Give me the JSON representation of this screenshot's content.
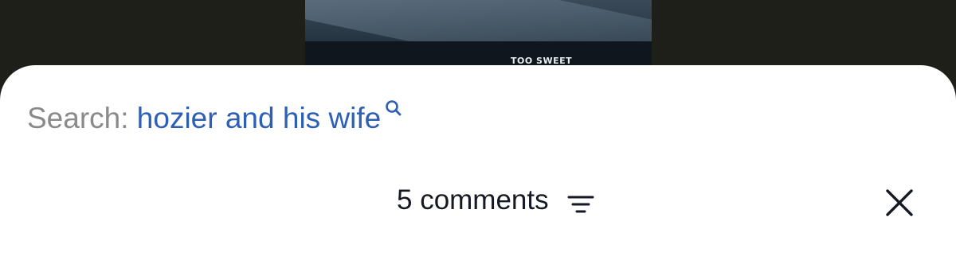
{
  "video": {
    "caption": "TOO SWEET"
  },
  "search": {
    "prefix": "Search:",
    "query": "hozier and his wife",
    "icon": "search-icon"
  },
  "comments_header": {
    "count_label": "5 comments",
    "sort_icon": "sort-icon",
    "close_icon": "close-icon"
  },
  "colors": {
    "backdrop": "#1f1f1a",
    "sheet": "#ffffff",
    "search_prefix": "#8a8a8a",
    "search_link": "#2d5fb4",
    "text": "#161823"
  }
}
